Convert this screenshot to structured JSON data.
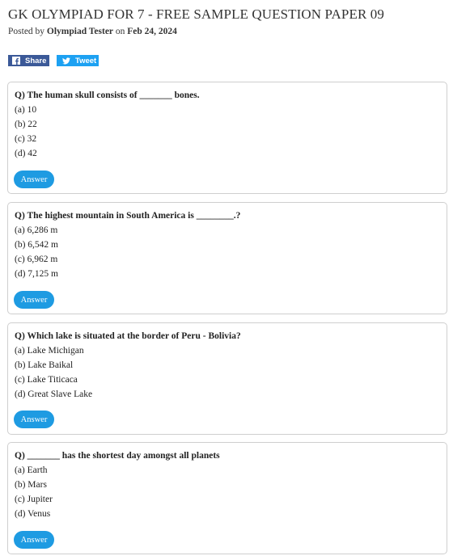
{
  "page": {
    "title": "GK OLYMPIAD FOR 7 - FREE SAMPLE QUESTION PAPER 09",
    "posted_by_prefix": "Posted by",
    "author": "Olympiad Tester",
    "on_word": "on",
    "date": "Feb 24, 2024"
  },
  "share": {
    "facebook_label": "Share",
    "twitter_label": "Tweet",
    "facebook_icon": "facebook-icon",
    "twitter_icon": "twitter-icon",
    "facebook_color": "#3b5998",
    "twitter_color": "#1da1f2"
  },
  "answer_button_color": "#1e9be2",
  "questions": [
    {
      "question": "Q) The human skull consists of _______ bones.",
      "options": [
        "(a) 10",
        "(b) 22",
        "(c) 32",
        "(d) 42"
      ],
      "answer_label": "Answer"
    },
    {
      "question": "Q) The highest mountain in South America is ________.?",
      "options": [
        "(a) 6,286 m",
        "(b) 6,542 m",
        "(c) 6,962 m",
        "(d) 7,125 m"
      ],
      "answer_label": "Answer"
    },
    {
      "question": "Q) Which lake is situated at the border of Peru - Bolivia?",
      "options": [
        "(a) Lake Michigan",
        "(b) Lake Baikal",
        "(c) Lake Titicaca",
        "(d) Great Slave Lake"
      ],
      "answer_label": "Answer"
    },
    {
      "question": "Q) _______ has the shortest day amongst all planets",
      "options": [
        "(a) Earth",
        "(b) Mars",
        "(c) Jupiter",
        "(d) Venus"
      ],
      "answer_label": "Answer"
    }
  ]
}
